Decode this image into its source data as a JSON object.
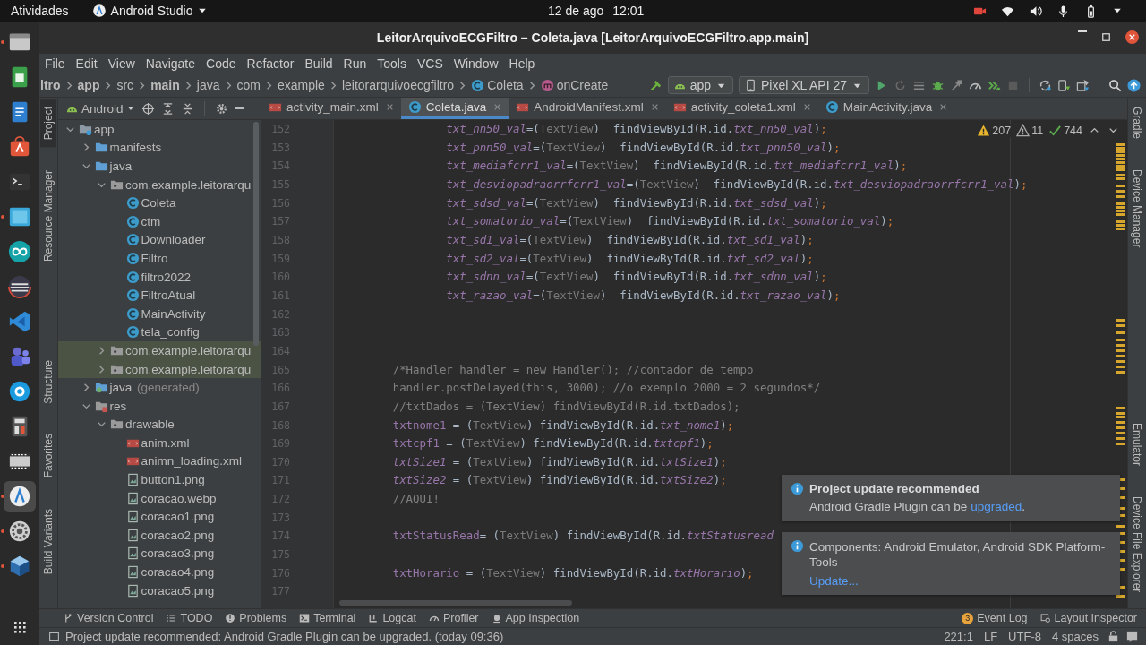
{
  "top_bar": {
    "activities": "Atividades",
    "app_menu": "Android Studio",
    "date": "12 de ago",
    "time": "12:01"
  },
  "dock": [
    {
      "kind": "files",
      "selected": false,
      "running": true
    },
    {
      "kind": "spreadsheet",
      "selected": false,
      "running": false
    },
    {
      "kind": "document",
      "selected": false,
      "running": false
    },
    {
      "kind": "store",
      "selected": false,
      "running": false
    },
    {
      "kind": "terminal",
      "selected": false,
      "running": false
    },
    {
      "kind": "screen",
      "selected": false,
      "running": true
    },
    {
      "kind": "infinity",
      "selected": false,
      "running": false
    },
    {
      "kind": "disk",
      "selected": false,
      "running": false
    },
    {
      "kind": "code",
      "selected": false,
      "running": false
    },
    {
      "kind": "people",
      "selected": false,
      "running": false
    },
    {
      "kind": "chat",
      "selected": false,
      "running": false
    },
    {
      "kind": "calculator",
      "selected": false,
      "running": false
    },
    {
      "kind": "film",
      "selected": false,
      "running": false
    },
    {
      "kind": "studio",
      "selected": true,
      "running": true
    },
    {
      "kind": "gear",
      "selected": false,
      "running": true
    },
    {
      "kind": "cube",
      "selected": false,
      "running": true
    }
  ],
  "window": {
    "title": "LeitorArquivoECGFiltro – Coleta.java [LeitorArquivoECGFiltro.app.main]"
  },
  "menu": [
    "File",
    "Edit",
    "View",
    "Navigate",
    "Code",
    "Refactor",
    "Build",
    "Run",
    "Tools",
    "VCS",
    "Window",
    "Help"
  ],
  "breadcrumbs": [
    {
      "kind": "plain",
      "label": "ltro",
      "bold": true
    },
    {
      "kind": "plain",
      "label": "app",
      "bold": true
    },
    {
      "kind": "plain",
      "label": "src",
      "bold": false
    },
    {
      "kind": "plain",
      "label": "main",
      "bold": true
    },
    {
      "kind": "plain",
      "label": "java",
      "bold": false
    },
    {
      "kind": "plain",
      "label": "com",
      "bold": false
    },
    {
      "kind": "plain",
      "label": "example",
      "bold": false
    },
    {
      "kind": "plain",
      "label": "leitorarquivoecgfiltro",
      "bold": false
    },
    {
      "kind": "class",
      "label": "Coleta",
      "bold": false
    },
    {
      "kind": "method",
      "label": "onCreate",
      "bold": false
    }
  ],
  "run_config": "app",
  "device": "Pixel XL API 27",
  "left_tool_windows": [
    {
      "label": "Project",
      "selected": true
    },
    {
      "label": "Resource Manager",
      "selected": false
    },
    {
      "label": "Structure",
      "selected": false
    },
    {
      "label": "Favorites",
      "selected": false
    },
    {
      "label": "Build Variants",
      "selected": false
    }
  ],
  "right_tool_windows": [
    {
      "label": "Gradle",
      "selected": false
    },
    {
      "label": "Device Manager",
      "selected": false
    },
    {
      "label": "Emulator",
      "selected": false
    },
    {
      "label": "Device File Explorer",
      "selected": false
    }
  ],
  "project": {
    "view": "Android",
    "tree": [
      {
        "label": "app",
        "kind": "module",
        "selected": false,
        "expanded": true,
        "children": [
          {
            "label": "manifests",
            "kind": "folder",
            "selected": false,
            "expanded": false
          },
          {
            "label": "java",
            "kind": "folder",
            "selected": false,
            "expanded": true,
            "children": [
              {
                "label": "com.example.leitorarqu",
                "kind": "package",
                "selected": false,
                "expanded": true,
                "children": [
                  {
                    "label": "Coleta",
                    "kind": "class",
                    "selected": false
                  },
                  {
                    "label": "ctm",
                    "kind": "class",
                    "selected": false
                  },
                  {
                    "label": "Downloader",
                    "kind": "class",
                    "selected": false
                  },
                  {
                    "label": "Filtro",
                    "kind": "class",
                    "selected": false
                  },
                  {
                    "label": "filtro2022",
                    "kind": "class",
                    "selected": false
                  },
                  {
                    "label": "FiltroAtual",
                    "kind": "class",
                    "selected": false
                  },
                  {
                    "label": "MainActivity",
                    "kind": "class",
                    "selected": false
                  },
                  {
                    "label": "tela_config",
                    "kind": "class",
                    "selected": false
                  }
                ]
              },
              {
                "label": "com.example.leitorarqu",
                "kind": "package",
                "selected": true,
                "expanded": false
              },
              {
                "label": "com.example.leitorarqu",
                "kind": "package",
                "selected": true,
                "expanded": false
              }
            ]
          },
          {
            "label": "java",
            "note": "(generated)",
            "kind": "generated",
            "selected": false,
            "expanded": false
          },
          {
            "label": "res",
            "kind": "resources",
            "selected": false,
            "expanded": true,
            "children": [
              {
                "label": "drawable",
                "kind": "package",
                "selected": false,
                "expanded": true,
                "children": [
                  {
                    "label": "anim.xml",
                    "kind": "xml",
                    "selected": false
                  },
                  {
                    "label": "animn_loading.xml",
                    "kind": "xml",
                    "selected": false
                  },
                  {
                    "label": "button1.png",
                    "kind": "image",
                    "selected": false
                  },
                  {
                    "label": "coracao.webp",
                    "kind": "image",
                    "selected": false
                  },
                  {
                    "label": "coracao1.png",
                    "kind": "image",
                    "selected": false
                  },
                  {
                    "label": "coracao2.png",
                    "kind": "image",
                    "selected": false
                  },
                  {
                    "label": "coracao3.png",
                    "kind": "image",
                    "selected": false
                  },
                  {
                    "label": "coracao4.png",
                    "kind": "image",
                    "selected": false
                  },
                  {
                    "label": "coracao5.png",
                    "kind": "image",
                    "selected": false
                  }
                ]
              }
            ]
          }
        ]
      }
    ]
  },
  "tabs": [
    {
      "label": "activity_main.xml",
      "kind": "xml",
      "selected": false
    },
    {
      "label": "Coleta.java",
      "kind": "class",
      "selected": true
    },
    {
      "label": "AndroidManifest.xml",
      "kind": "manifest",
      "selected": false
    },
    {
      "label": "activity_coleta1.xml",
      "kind": "xml",
      "selected": false
    },
    {
      "label": "MainActivity.java",
      "kind": "class",
      "selected": false
    }
  ],
  "inspections": {
    "warnings": "207",
    "weak_warnings": "11",
    "typos": "744"
  },
  "code": [
    {
      "number": "152",
      "indented": true,
      "tokens": [
        {
          "kind": "field",
          "text": "txt_nn50_val"
        },
        {
          "kind": "plain",
          "text": "=("
        },
        {
          "kind": "type",
          "text": "TextView"
        },
        {
          "kind": "plain",
          "text": ")  findViewById(R.id."
        },
        {
          "kind": "field",
          "text": "txt_nn50_val"
        },
        {
          "kind": "plain",
          "text": ")"
        },
        {
          "kind": "punct",
          "text": ";"
        }
      ]
    },
    {
      "number": "153",
      "indented": true,
      "tokens": [
        {
          "kind": "field",
          "text": "txt_pnn50_val"
        },
        {
          "kind": "plain",
          "text": "=("
        },
        {
          "kind": "type",
          "text": "TextView"
        },
        {
          "kind": "plain",
          "text": ")  findViewById(R.id."
        },
        {
          "kind": "field",
          "text": "txt_pnn50_val"
        },
        {
          "kind": "plain",
          "text": ")"
        },
        {
          "kind": "punct",
          "text": ";"
        }
      ]
    },
    {
      "number": "154",
      "indented": true,
      "tokens": [
        {
          "kind": "field",
          "text": "txt_mediafcrr1_val"
        },
        {
          "kind": "plain",
          "text": "=("
        },
        {
          "kind": "type",
          "text": "TextView"
        },
        {
          "kind": "plain",
          "text": ")  findViewById(R.id."
        },
        {
          "kind": "field",
          "text": "txt_mediafcrr1_val"
        },
        {
          "kind": "plain",
          "text": ")"
        },
        {
          "kind": "punct",
          "text": ";"
        }
      ]
    },
    {
      "number": "155",
      "indented": true,
      "tokens": [
        {
          "kind": "field",
          "text": "txt_desviopadraorrfcrr1_val"
        },
        {
          "kind": "plain",
          "text": "=("
        },
        {
          "kind": "type",
          "text": "TextView"
        },
        {
          "kind": "plain",
          "text": ")  findViewById(R.id."
        },
        {
          "kind": "field",
          "text": "txt_desviopadraorrfcrr1_val"
        },
        {
          "kind": "plain",
          "text": ")"
        },
        {
          "kind": "punct",
          "text": ";"
        }
      ]
    },
    {
      "number": "156",
      "indented": true,
      "tokens": [
        {
          "kind": "field",
          "text": "txt_sdsd_val"
        },
        {
          "kind": "plain",
          "text": "=("
        },
        {
          "kind": "type",
          "text": "TextView"
        },
        {
          "kind": "plain",
          "text": ")  findViewById(R.id."
        },
        {
          "kind": "field",
          "text": "txt_sdsd_val"
        },
        {
          "kind": "plain",
          "text": ")"
        },
        {
          "kind": "punct",
          "text": ";"
        }
      ]
    },
    {
      "number": "157",
      "indented": true,
      "tokens": [
        {
          "kind": "field",
          "text": "txt_somatorio_val"
        },
        {
          "kind": "plain",
          "text": "=("
        },
        {
          "kind": "type",
          "text": "TextView"
        },
        {
          "kind": "plain",
          "text": ")  findViewById(R.id."
        },
        {
          "kind": "field",
          "text": "txt_somatorio_val"
        },
        {
          "kind": "plain",
          "text": ")"
        },
        {
          "kind": "punct",
          "text": ";"
        }
      ]
    },
    {
      "number": "158",
      "indented": true,
      "tokens": [
        {
          "kind": "field",
          "text": "txt_sd1_val"
        },
        {
          "kind": "plain",
          "text": "=("
        },
        {
          "kind": "type",
          "text": "TextView"
        },
        {
          "kind": "plain",
          "text": ")  findViewById(R.id."
        },
        {
          "kind": "field",
          "text": "txt_sd1_val"
        },
        {
          "kind": "plain",
          "text": ")"
        },
        {
          "kind": "punct",
          "text": ";"
        }
      ]
    },
    {
      "number": "159",
      "indented": true,
      "tokens": [
        {
          "kind": "field",
          "text": "txt_sd2_val"
        },
        {
          "kind": "plain",
          "text": "=("
        },
        {
          "kind": "type",
          "text": "TextView"
        },
        {
          "kind": "plain",
          "text": ")  findViewById(R.id."
        },
        {
          "kind": "field",
          "text": "txt_sd2_val"
        },
        {
          "kind": "plain",
          "text": ")"
        },
        {
          "kind": "punct",
          "text": ";"
        }
      ]
    },
    {
      "number": "160",
      "indented": true,
      "tokens": [
        {
          "kind": "field",
          "text": "txt_sdnn_val"
        },
        {
          "kind": "plain",
          "text": "=("
        },
        {
          "kind": "type",
          "text": "TextView"
        },
        {
          "kind": "plain",
          "text": ")  findViewById(R.id."
        },
        {
          "kind": "field",
          "text": "txt_sdnn_val"
        },
        {
          "kind": "plain",
          "text": ")"
        },
        {
          "kind": "punct",
          "text": ";"
        }
      ]
    },
    {
      "number": "161",
      "indented": true,
      "tokens": [
        {
          "kind": "field",
          "text": "txt_razao_val"
        },
        {
          "kind": "plain",
          "text": "=("
        },
        {
          "kind": "type",
          "text": "TextView"
        },
        {
          "kind": "plain",
          "text": ")  findViewById(R.id."
        },
        {
          "kind": "field",
          "text": "txt_razao_val"
        },
        {
          "kind": "plain",
          "text": ")"
        },
        {
          "kind": "punct",
          "text": ";"
        }
      ]
    },
    {
      "number": "162"
    },
    {
      "number": "163"
    },
    {
      "number": "164"
    },
    {
      "number": "165",
      "indented": false,
      "tokens": [
        {
          "kind": "comment",
          "text": "/*Handler handler = new Handler(); //contador de tempo"
        }
      ]
    },
    {
      "number": "166",
      "indented": false,
      "tokens": [
        {
          "kind": "comment",
          "text": "handler.postDelayed(this, 3000); //o exemplo 2000 = 2 segundos*/"
        }
      ]
    },
    {
      "number": "167",
      "indented": false,
      "tokens": [
        {
          "kind": "comment",
          "text": "//txtDados = (TextView) findViewById(R.id.txtDados);"
        }
      ]
    },
    {
      "number": "168",
      "indented": false,
      "tokens": [
        {
          "kind": "var",
          "text": "txtnome1"
        },
        {
          "kind": "plain",
          "text": " = ("
        },
        {
          "kind": "type",
          "text": "TextView"
        },
        {
          "kind": "plain",
          "text": ") findViewById(R.id."
        },
        {
          "kind": "field",
          "text": "txt_nome1"
        },
        {
          "kind": "plain",
          "text": ")"
        },
        {
          "kind": "punct",
          "text": ";"
        }
      ]
    },
    {
      "number": "169",
      "indented": false,
      "tokens": [
        {
          "kind": "var",
          "text": "txtcpf1"
        },
        {
          "kind": "plain",
          "text": " = ("
        },
        {
          "kind": "type",
          "text": "TextView"
        },
        {
          "kind": "plain",
          "text": ") findViewById(R.id."
        },
        {
          "kind": "field",
          "text": "txtcpf1"
        },
        {
          "kind": "plain",
          "text": ")"
        },
        {
          "kind": "punct",
          "text": ";"
        }
      ]
    },
    {
      "number": "170",
      "indented": false,
      "tokens": [
        {
          "kind": "field",
          "text": "txtSize1"
        },
        {
          "kind": "plain",
          "text": " = ("
        },
        {
          "kind": "type",
          "text": "TextView"
        },
        {
          "kind": "plain",
          "text": ") findViewById(R.id."
        },
        {
          "kind": "field",
          "text": "txtSize1"
        },
        {
          "kind": "plain",
          "text": ")"
        },
        {
          "kind": "punct",
          "text": ";"
        }
      ]
    },
    {
      "number": "171",
      "indented": false,
      "tokens": [
        {
          "kind": "field",
          "text": "txtSize2"
        },
        {
          "kind": "plain",
          "text": " = ("
        },
        {
          "kind": "type",
          "text": "TextView"
        },
        {
          "kind": "plain",
          "text": ") findViewById(R.id."
        },
        {
          "kind": "field",
          "text": "txtSize2"
        },
        {
          "kind": "plain",
          "text": ")"
        },
        {
          "kind": "punct",
          "text": ";"
        }
      ]
    },
    {
      "number": "172",
      "indented": false,
      "tokens": [
        {
          "kind": "comment",
          "text": "//AQUI!"
        }
      ]
    },
    {
      "number": "173"
    },
    {
      "number": "174",
      "indented": false,
      "tokens": [
        {
          "kind": "var",
          "text": "txtStatusRead"
        },
        {
          "kind": "plain",
          "text": "= ("
        },
        {
          "kind": "type",
          "text": "TextView"
        },
        {
          "kind": "plain",
          "text": ") findViewById(R.id."
        },
        {
          "kind": "field",
          "text": "txtStatusread"
        }
      ]
    },
    {
      "number": "175"
    },
    {
      "number": "176",
      "indented": false,
      "tokens": [
        {
          "kind": "var",
          "text": "txtHorario"
        },
        {
          "kind": "plain",
          "text": " = ("
        },
        {
          "kind": "type",
          "text": "TextView"
        },
        {
          "kind": "plain",
          "text": ") findViewById(R.id."
        },
        {
          "kind": "field",
          "text": "txtHorario"
        },
        {
          "kind": "plain",
          "text": ")"
        },
        {
          "kind": "punct",
          "text": ";"
        }
      ]
    },
    {
      "number": "177"
    }
  ],
  "notifications": [
    {
      "title": "Project update recommended",
      "text": "Android Gradle Plugin can be ",
      "link": "upgraded",
      "after": "."
    },
    {
      "text": "Components: Android Emulator, Android SDK Platform-Tools",
      "link": "Update..."
    }
  ],
  "bottom_tools": [
    {
      "kind": "vcs",
      "label": "Version Control"
    },
    {
      "kind": "todo",
      "label": "TODO"
    },
    {
      "kind": "problems",
      "label": "Problems"
    },
    {
      "kind": "terminal",
      "label": "Terminal"
    },
    {
      "kind": "logcat",
      "label": "Logcat"
    },
    {
      "kind": "profiler",
      "label": "Profiler"
    },
    {
      "kind": "inspection",
      "label": "App Inspection"
    }
  ],
  "bottom_tools_right": [
    {
      "kind": "eventlog",
      "label": "Event Log",
      "badge": "3"
    },
    {
      "kind": "layout",
      "label": "Layout Inspector"
    }
  ],
  "status_bar": {
    "message": "Project update recommended: Android Gradle Plugin can be upgraded. (today 09:36)",
    "position": "221:1",
    "line_separator": "LF",
    "encoding": "UTF-8",
    "indent": "4 spaces"
  }
}
